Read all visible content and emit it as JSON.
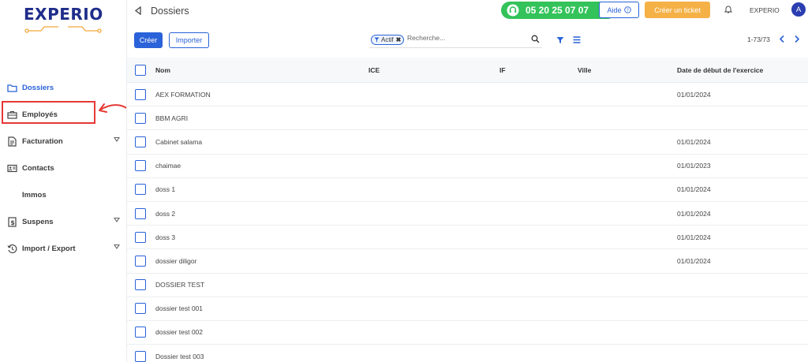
{
  "brand": {
    "logo_text": "EXPERIO",
    "accent": "#2a62d9",
    "logo_color": "#1f2d8a"
  },
  "sidebar": {
    "items": [
      {
        "label": "Dossiers",
        "icon": "folder-icon",
        "active": true,
        "expandable": false
      },
      {
        "label": "Employés",
        "icon": "briefcase-icon",
        "active": false,
        "expandable": false,
        "highlighted": true
      },
      {
        "label": "Facturation",
        "icon": "document-icon",
        "active": false,
        "expandable": true
      },
      {
        "label": "Contacts",
        "icon": "id-card-icon",
        "active": false,
        "expandable": false
      },
      {
        "label": "Immos",
        "icon": "",
        "active": false,
        "expandable": false
      },
      {
        "label": "Suspens",
        "icon": "dollar-doc-icon",
        "active": false,
        "expandable": true
      },
      {
        "label": "Import / Export",
        "icon": "history-icon",
        "active": false,
        "expandable": true
      }
    ]
  },
  "header": {
    "title": "Dossiers",
    "phone": "05 20 25 07 07",
    "help_label": "Aide",
    "ticket_label": "Créer un ticket",
    "user_name": "EXPERIO",
    "avatar_initial": "A"
  },
  "toolbar": {
    "create_label": "Créer",
    "import_label": "Importer",
    "facet_label": "Actif",
    "search_placeholder": "Recherche...",
    "pager": "1-73/73"
  },
  "table": {
    "columns": [
      "Nom",
      "ICE",
      "IF",
      "Ville",
      "Date de début de l'exercice"
    ],
    "rows": [
      {
        "nom": "AEX FORMATION",
        "ice": "",
        "if": "",
        "ville": "",
        "date": "01/01/2024"
      },
      {
        "nom": "BBM AGRI",
        "ice": "",
        "if": "",
        "ville": "",
        "date": ""
      },
      {
        "nom": "Cabinet salama",
        "ice": "",
        "if": "",
        "ville": "",
        "date": "01/01/2024"
      },
      {
        "nom": "chaimae",
        "ice": "",
        "if": "",
        "ville": "",
        "date": "01/01/2023"
      },
      {
        "nom": "doss 1",
        "ice": "",
        "if": "",
        "ville": "",
        "date": "01/01/2024"
      },
      {
        "nom": "doss 2",
        "ice": "",
        "if": "",
        "ville": "",
        "date": "01/01/2024"
      },
      {
        "nom": "doss 3",
        "ice": "",
        "if": "",
        "ville": "",
        "date": "01/01/2024"
      },
      {
        "nom": "dossier diligor",
        "ice": "",
        "if": "",
        "ville": "",
        "date": "01/01/2024"
      },
      {
        "nom": "DOSSIER TEST",
        "ice": "",
        "if": "",
        "ville": "",
        "date": ""
      },
      {
        "nom": "dossier test 001",
        "ice": "",
        "if": "",
        "ville": "",
        "date": ""
      },
      {
        "nom": "dossier test 002",
        "ice": "",
        "if": "",
        "ville": "",
        "date": ""
      },
      {
        "nom": "Dossier test 003",
        "ice": "",
        "if": "",
        "ville": "",
        "date": ""
      }
    ]
  }
}
